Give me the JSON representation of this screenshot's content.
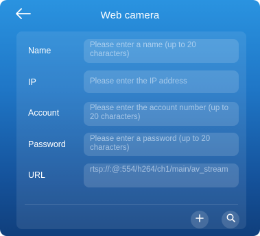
{
  "header": {
    "title": "Web camera",
    "back_icon": "arrow-left-icon"
  },
  "form": {
    "fields": [
      {
        "label": "Name",
        "placeholder": "Please enter a name (up to 20 characters)",
        "value": ""
      },
      {
        "label": "IP",
        "placeholder": "Please enter the IP address",
        "value": ""
      },
      {
        "label": "Account",
        "placeholder": "Please enter the account number (up to 20 characters)",
        "value": ""
      },
      {
        "label": "Password",
        "placeholder": "Please enter a password (up to 20 characters)",
        "value": ""
      },
      {
        "label": "URL",
        "placeholder": "rtsp://:@:554/h264/ch1/main/av_stream",
        "value": ""
      }
    ]
  },
  "actions": {
    "add_icon": "plus-icon",
    "search_icon": "search-icon"
  },
  "colors": {
    "background_top": "#2a93e0",
    "background_bottom": "#103f7c",
    "text": "#ffffff"
  }
}
